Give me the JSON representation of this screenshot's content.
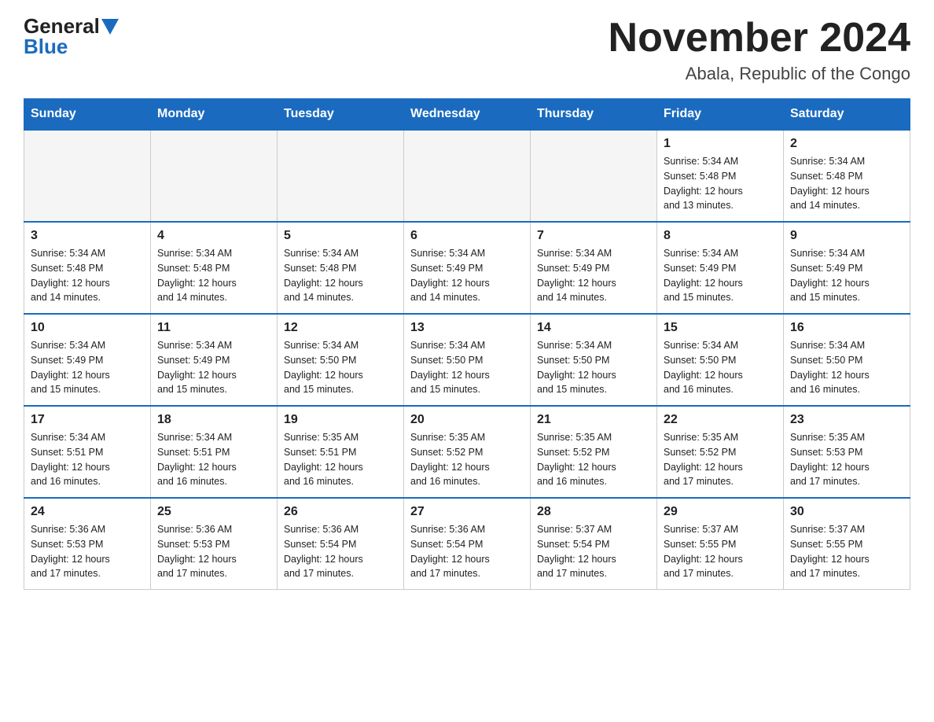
{
  "header": {
    "logo_general": "General",
    "logo_blue": "Blue",
    "month_title": "November 2024",
    "location": "Abala, Republic of the Congo"
  },
  "days_of_week": [
    "Sunday",
    "Monday",
    "Tuesday",
    "Wednesday",
    "Thursday",
    "Friday",
    "Saturday"
  ],
  "weeks": [
    [
      {
        "day": "",
        "info": ""
      },
      {
        "day": "",
        "info": ""
      },
      {
        "day": "",
        "info": ""
      },
      {
        "day": "",
        "info": ""
      },
      {
        "day": "",
        "info": ""
      },
      {
        "day": "1",
        "info": "Sunrise: 5:34 AM\nSunset: 5:48 PM\nDaylight: 12 hours\nand 13 minutes."
      },
      {
        "day": "2",
        "info": "Sunrise: 5:34 AM\nSunset: 5:48 PM\nDaylight: 12 hours\nand 14 minutes."
      }
    ],
    [
      {
        "day": "3",
        "info": "Sunrise: 5:34 AM\nSunset: 5:48 PM\nDaylight: 12 hours\nand 14 minutes."
      },
      {
        "day": "4",
        "info": "Sunrise: 5:34 AM\nSunset: 5:48 PM\nDaylight: 12 hours\nand 14 minutes."
      },
      {
        "day": "5",
        "info": "Sunrise: 5:34 AM\nSunset: 5:48 PM\nDaylight: 12 hours\nand 14 minutes."
      },
      {
        "day": "6",
        "info": "Sunrise: 5:34 AM\nSunset: 5:49 PM\nDaylight: 12 hours\nand 14 minutes."
      },
      {
        "day": "7",
        "info": "Sunrise: 5:34 AM\nSunset: 5:49 PM\nDaylight: 12 hours\nand 14 minutes."
      },
      {
        "day": "8",
        "info": "Sunrise: 5:34 AM\nSunset: 5:49 PM\nDaylight: 12 hours\nand 15 minutes."
      },
      {
        "day": "9",
        "info": "Sunrise: 5:34 AM\nSunset: 5:49 PM\nDaylight: 12 hours\nand 15 minutes."
      }
    ],
    [
      {
        "day": "10",
        "info": "Sunrise: 5:34 AM\nSunset: 5:49 PM\nDaylight: 12 hours\nand 15 minutes."
      },
      {
        "day": "11",
        "info": "Sunrise: 5:34 AM\nSunset: 5:49 PM\nDaylight: 12 hours\nand 15 minutes."
      },
      {
        "day": "12",
        "info": "Sunrise: 5:34 AM\nSunset: 5:50 PM\nDaylight: 12 hours\nand 15 minutes."
      },
      {
        "day": "13",
        "info": "Sunrise: 5:34 AM\nSunset: 5:50 PM\nDaylight: 12 hours\nand 15 minutes."
      },
      {
        "day": "14",
        "info": "Sunrise: 5:34 AM\nSunset: 5:50 PM\nDaylight: 12 hours\nand 15 minutes."
      },
      {
        "day": "15",
        "info": "Sunrise: 5:34 AM\nSunset: 5:50 PM\nDaylight: 12 hours\nand 16 minutes."
      },
      {
        "day": "16",
        "info": "Sunrise: 5:34 AM\nSunset: 5:50 PM\nDaylight: 12 hours\nand 16 minutes."
      }
    ],
    [
      {
        "day": "17",
        "info": "Sunrise: 5:34 AM\nSunset: 5:51 PM\nDaylight: 12 hours\nand 16 minutes."
      },
      {
        "day": "18",
        "info": "Sunrise: 5:34 AM\nSunset: 5:51 PM\nDaylight: 12 hours\nand 16 minutes."
      },
      {
        "day": "19",
        "info": "Sunrise: 5:35 AM\nSunset: 5:51 PM\nDaylight: 12 hours\nand 16 minutes."
      },
      {
        "day": "20",
        "info": "Sunrise: 5:35 AM\nSunset: 5:52 PM\nDaylight: 12 hours\nand 16 minutes."
      },
      {
        "day": "21",
        "info": "Sunrise: 5:35 AM\nSunset: 5:52 PM\nDaylight: 12 hours\nand 16 minutes."
      },
      {
        "day": "22",
        "info": "Sunrise: 5:35 AM\nSunset: 5:52 PM\nDaylight: 12 hours\nand 17 minutes."
      },
      {
        "day": "23",
        "info": "Sunrise: 5:35 AM\nSunset: 5:53 PM\nDaylight: 12 hours\nand 17 minutes."
      }
    ],
    [
      {
        "day": "24",
        "info": "Sunrise: 5:36 AM\nSunset: 5:53 PM\nDaylight: 12 hours\nand 17 minutes."
      },
      {
        "day": "25",
        "info": "Sunrise: 5:36 AM\nSunset: 5:53 PM\nDaylight: 12 hours\nand 17 minutes."
      },
      {
        "day": "26",
        "info": "Sunrise: 5:36 AM\nSunset: 5:54 PM\nDaylight: 12 hours\nand 17 minutes."
      },
      {
        "day": "27",
        "info": "Sunrise: 5:36 AM\nSunset: 5:54 PM\nDaylight: 12 hours\nand 17 minutes."
      },
      {
        "day": "28",
        "info": "Sunrise: 5:37 AM\nSunset: 5:54 PM\nDaylight: 12 hours\nand 17 minutes."
      },
      {
        "day": "29",
        "info": "Sunrise: 5:37 AM\nSunset: 5:55 PM\nDaylight: 12 hours\nand 17 minutes."
      },
      {
        "day": "30",
        "info": "Sunrise: 5:37 AM\nSunset: 5:55 PM\nDaylight: 12 hours\nand 17 minutes."
      }
    ]
  ]
}
